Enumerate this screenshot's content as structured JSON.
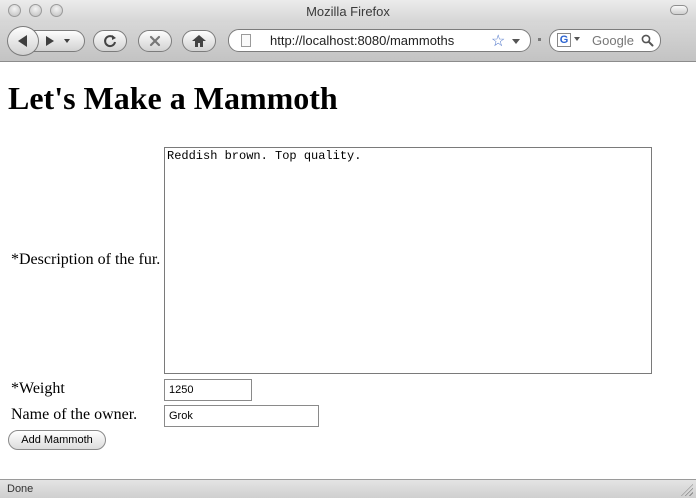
{
  "window": {
    "title": "Mozilla Firefox"
  },
  "toolbar": {
    "url": "http://localhost:8080/mammoths",
    "search_placeholder": "Google",
    "search_engine_letter": "G"
  },
  "page": {
    "title": "Let's Make a Mammoth",
    "form": {
      "fur_label": "*Description of the fur.",
      "fur_value": "Reddish brown. Top quality.",
      "weight_label": "*Weight",
      "weight_value": "1250",
      "owner_label": "Name of the owner.",
      "owner_value": "Grok",
      "submit_label": "Add Mammoth"
    }
  },
  "status": {
    "text": "Done"
  }
}
